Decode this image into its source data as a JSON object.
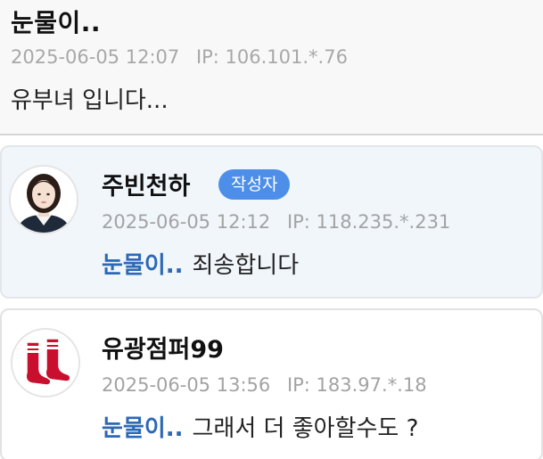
{
  "comments": [
    {
      "author": "눈물이..",
      "date": "2025-06-05 12:07",
      "ip": "IP: 106.101.*.76",
      "text": "유부녀 입니다..."
    },
    {
      "author": "주빈천하",
      "badge": "작성자",
      "date": "2025-06-05 12:12",
      "ip": "IP: 118.235.*.231",
      "mention": "눈물이..",
      "text": "죄송합니다",
      "avatar_icon": "profile-photo-woman"
    },
    {
      "author": "유광점퍼99",
      "date": "2025-06-05 13:56",
      "ip": "IP: 183.97.*.18",
      "mention": "눈물이..",
      "text": "그래서 더 좋아할수도 ?",
      "avatar_icon": "red-sox-logo"
    }
  ],
  "colors": {
    "badge": "#4d8ee8",
    "mention": "#2d68b6",
    "highlight_bg": "#f1f6fb",
    "meta": "#a3a3a3"
  }
}
